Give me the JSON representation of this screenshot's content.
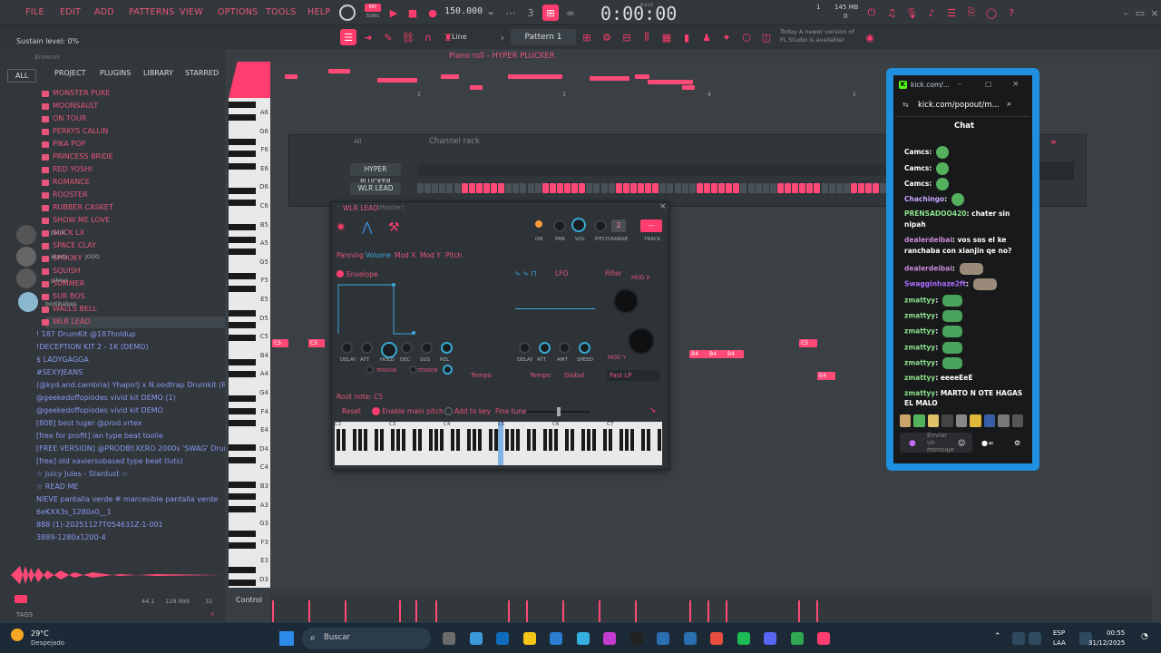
{
  "menu": [
    "FILE",
    "EDIT",
    "ADD",
    "PATTERNS",
    "VIEW",
    "OPTIONS",
    "TOOLS",
    "HELP"
  ],
  "transport": {
    "tempo": "150.000",
    "time": "0:00:00",
    "mode_pat": "PAT",
    "mode_song": "SONG",
    "mics": "M:S:CS",
    "cpu": "1",
    "mem": "145 MB",
    "cpu2": "0"
  },
  "toolbar2": {
    "snap": "Line",
    "pattern": "Pattern 1",
    "update_line1": "Today  A newer version of",
    "update_line2": "FL Studio is available!"
  },
  "hint": "Sustain level: 0%",
  "browser": {
    "title": "Browser",
    "tabs": [
      "ALL",
      "PROJECT",
      "PLUGINS",
      "LIBRARY",
      "STARRED"
    ],
    "folders": [
      "MONSTER PUKE",
      "MOONSAULT",
      "ON TOUR",
      "PERKYS CALLIN",
      "PIKA POP",
      "PRINCESS BRIDE",
      "RED YOSHI",
      "ROMANCE",
      "ROOSTER",
      "RUBBER CASKET",
      "SHOW ME LOVE",
      "SLICK LX",
      "SPACE CLAY",
      "SPOOKY",
      "SQUISH",
      "SUMMER",
      "SUR BOS",
      "WALLS BELL",
      "WLR LEAD"
    ],
    "items": [
      "! 187 DrumKit @187holdup",
      "!DECEPTION KIT 2 - 1K (DEMO)",
      "$ LADYGAGGA",
      "#SEXYJEANS",
      "(@kyd.and.cambria) Yhapo!J x N.oodtrap Drumkit (Rare Shit)",
      "@geekedoffopiodes vivid kit DEMO (1)",
      "@geekedoffopiodes vivid kit DEMO",
      "[808] best luger @prod.vrtex",
      "[free for profit] ian type beat toolie",
      "[FREE VERSION] @PRODBY.XERO 2000s 'SWAG' Drum Kit",
      "[free] old xaviersobased type beat (luts)",
      "☆ Juicy Jules - Stardust ☆",
      "☆ READ ME",
      "NIEVE pantalla verde ❄ marcesible pantalla verde",
      "6eKXX3s_1280x0__1",
      "888 (1)-20251127T054631Z-1-001",
      "3889-1280x1200-4"
    ],
    "status_left": "44.1",
    "status_mid": "129.999",
    "status_right": "32",
    "tags": "TAGS",
    "overlay_users": [
      "panic",
      "akerla",
      "pikeur",
      "bootikalpes",
      "JODO"
    ]
  },
  "pianoroll": {
    "title": "Piano roll - HYPER PLUCKER",
    "bars": [
      "2",
      "3",
      "4",
      "5"
    ],
    "keys": [
      "A6",
      "G6",
      "F6",
      "E6",
      "D6",
      "C6",
      "B5",
      "A5",
      "G5",
      "F5",
      "E5",
      "D5",
      "C5",
      "B4",
      "A4",
      "G4",
      "F4",
      "E4",
      "D4",
      "C4",
      "B3",
      "A3",
      "G3",
      "F3",
      "E3",
      "D3"
    ],
    "note_labels": [
      "C5",
      "C5",
      "B4",
      "B4",
      "B4",
      "C5",
      "E4"
    ],
    "control": "Control"
  },
  "rack": {
    "title": "Channel rack",
    "filter": "All",
    "channels": [
      "HYPER PLUCKER",
      "WLR LEAD"
    ]
  },
  "plugin": {
    "title": "WLR LEAD",
    "subtitle": "(Master)",
    "top_knobs": [
      "ON",
      "PAN",
      "VOL",
      "PITCH",
      "RANGE",
      "TRACK"
    ],
    "range_value": "2",
    "track_value": "---",
    "tabs": [
      "Panning",
      "Volume",
      "Mod X",
      "Mod Y",
      "Pitch"
    ],
    "envelope": "Envelope",
    "lfo": "LFO",
    "filter": "Filter",
    "mod_x": "MOD X",
    "mod_y": "MOD Y",
    "env_knobs": [
      "DELAY",
      "ATT",
      "HOLD",
      "DEC",
      "SUS",
      "REL"
    ],
    "tension": "TENSION",
    "lfo_knobs": [
      "DELAY",
      "ATT",
      "AMT",
      "SPEED"
    ],
    "tempo": "Tempo",
    "global": "Global",
    "filter_type": "Fast LP",
    "root_note": "Root note: C5",
    "reset": "Reset",
    "enable_pitch": "Enable main pitch",
    "add_key": "Add to key",
    "fine_tune": "Fine tune",
    "octaves": [
      "C2",
      "C3",
      "C4",
      "C5",
      "C6",
      "C7"
    ]
  },
  "kick": {
    "tab_title": "kick.com/...",
    "url": "kick.com/popout/m...",
    "chat_title": "Chat",
    "messages": [
      {
        "user": "Camcs",
        "color": "#ffffff",
        "text": ""
      },
      {
        "user": "Camcs",
        "color": "#ffffff",
        "text": ""
      },
      {
        "user": "Camcs",
        "color": "#ffffff",
        "text": ""
      },
      {
        "user": "Chachingo",
        "color": "#c9a8ff",
        "text": ""
      },
      {
        "user": "PRENSADOO420",
        "color": "#8be28b",
        "text": "chater sin"
      },
      {
        "user": "",
        "color": "#ffffff",
        "text": "nipah"
      },
      {
        "user": "dealerdeibai",
        "color": "#c98bd6",
        "text": "vos sos el ke"
      },
      {
        "user": "",
        "color": "#ffffff",
        "text": "ranchaba con xianjin qe no?"
      },
      {
        "user": "dealerdeibai",
        "color": "#c98bd6",
        "text": ""
      },
      {
        "user": "Swagginhaze2ft",
        "color": "#b06cff",
        "text": ""
      },
      {
        "user": "zmattyy",
        "color": "#8be28b",
        "text": ""
      },
      {
        "user": "zmattyy",
        "color": "#8be28b",
        "text": ""
      },
      {
        "user": "zmattyy",
        "color": "#8be28b",
        "text": ""
      },
      {
        "user": "zmattyy",
        "color": "#8be28b",
        "text": ""
      },
      {
        "user": "zmattyy",
        "color": "#8be28b",
        "text": ""
      },
      {
        "user": "zmattyy",
        "color": "#8be28b",
        "text": "eeeeEeE"
      },
      {
        "user": "zmattyy",
        "color": "#8be28b",
        "text": "MARTO N OTE HAGAS"
      },
      {
        "user": "",
        "color": "#ffffff",
        "text": "EL MALO"
      }
    ],
    "input_placeholder": "Enviar un mensaje"
  },
  "taskbar": {
    "weather_temp": "29°C",
    "weather_desc": "Despejado",
    "search": "Buscar",
    "lang1": "ESP",
    "lang2": "LAA",
    "time": "00:55",
    "date": "31/12/2025"
  },
  "colors": {
    "accent": "#ff3d6e",
    "kick_border": "#1f8fe0",
    "kick_green": "#53fc18"
  }
}
